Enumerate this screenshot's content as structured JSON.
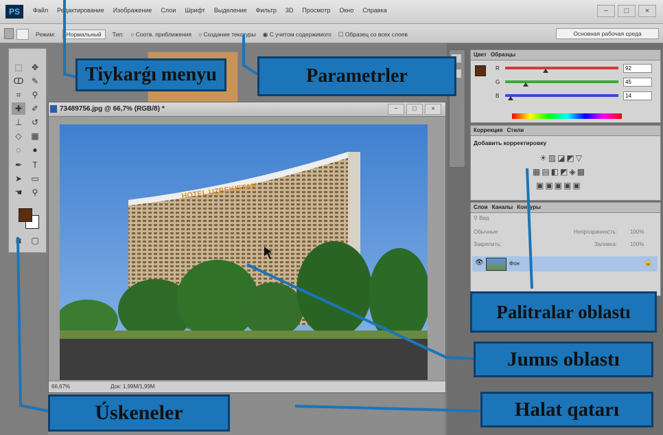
{
  "menubar": {
    "logo": "PS",
    "items": [
      "Файл",
      "Редактирование",
      "Изображение",
      "Слои",
      "Шрифт",
      "Выделение",
      "Фильтр",
      "3D",
      "Просмотр",
      "Окно",
      "Справка"
    ],
    "window_buttons": [
      "−",
      "□",
      "×"
    ]
  },
  "options_bar": {
    "mode_label": "Режим:",
    "mode_value": "Нормальный",
    "type_label": "Тип:",
    "radio1": "Соотв. приближения",
    "radio2": "Создание текстуры",
    "radio3": "С учетом содержимого",
    "checkbox": "Образец со всех слоев",
    "workspace": "Основная рабочая среда"
  },
  "document": {
    "title": "73489756.jpg @ 66,7% (RGB/8) *",
    "zoom": "66,67%",
    "info": "Док: 1,99M/1,99M",
    "sign_text": "HOTEL UZBEKISTAN"
  },
  "color_panel": {
    "tabs": [
      "Цвет",
      "Образцы"
    ],
    "channels": [
      {
        "label": "R",
        "value": "92",
        "color": "#d23a3a",
        "level": 0.36
      },
      {
        "label": "G",
        "value": "45",
        "color": "#3aa83a",
        "level": 0.18
      },
      {
        "label": "B",
        "value": "14",
        "color": "#3a4ad2",
        "level": 0.05
      }
    ]
  },
  "corrections_panel": {
    "tabs": [
      "Коррекция",
      "Стили"
    ],
    "title": "Добавить корректировку"
  },
  "layers_panel": {
    "tabs": [
      "Слои",
      "Каналы",
      "Контуры"
    ],
    "kind_label": "Вид",
    "blend_mode": "Обычные",
    "opacity_label": "Непрозрачность:",
    "opacity_value": "100%",
    "lock_label": "Закрепить:",
    "fill_label": "Заливка:",
    "fill_value": "100%",
    "layer_name": "Фон"
  },
  "callouts": {
    "menu": "Tiykarǵı menyu",
    "params": "Parametrler",
    "palettes": "Palitralar oblastı",
    "work": "Jumıs oblastı",
    "status": "Halat qatarı",
    "tools": "Úskeneler"
  },
  "colors": {
    "callout_fill": "#1b75b8",
    "callout_border": "#0c3f6d",
    "pointer_line": "#1b75b8",
    "foreground_color": "#5c2d0e"
  }
}
